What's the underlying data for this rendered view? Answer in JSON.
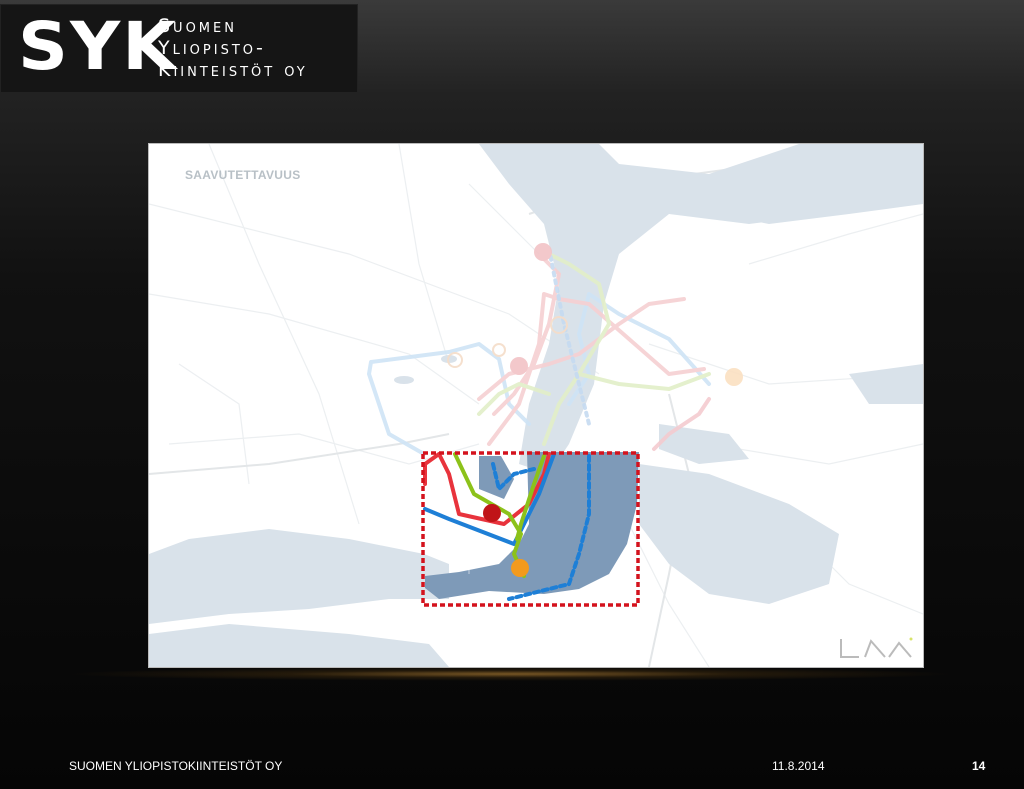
{
  "logo": {
    "mark": "SYK",
    "line1": "Suomen",
    "line2": "Yliopisto-",
    "line3": "Kiinteistöt oy"
  },
  "map": {
    "title": "SAAVUTETTAVUUS",
    "colors": {
      "water": "#d9e2ea",
      "water_focus": "#7e9ab8",
      "route_blue": "#1e7fd6",
      "route_red": "#e8333c",
      "route_green": "#8cc21a",
      "focus_border": "#d4121d",
      "marker_red": "#c01418",
      "marker_orange": "#f39a1e"
    }
  },
  "footer": {
    "company": "SUOMEN YLIOPISTOKIINTEISTÖT OY",
    "date": "11.8.2014",
    "page": "14"
  }
}
